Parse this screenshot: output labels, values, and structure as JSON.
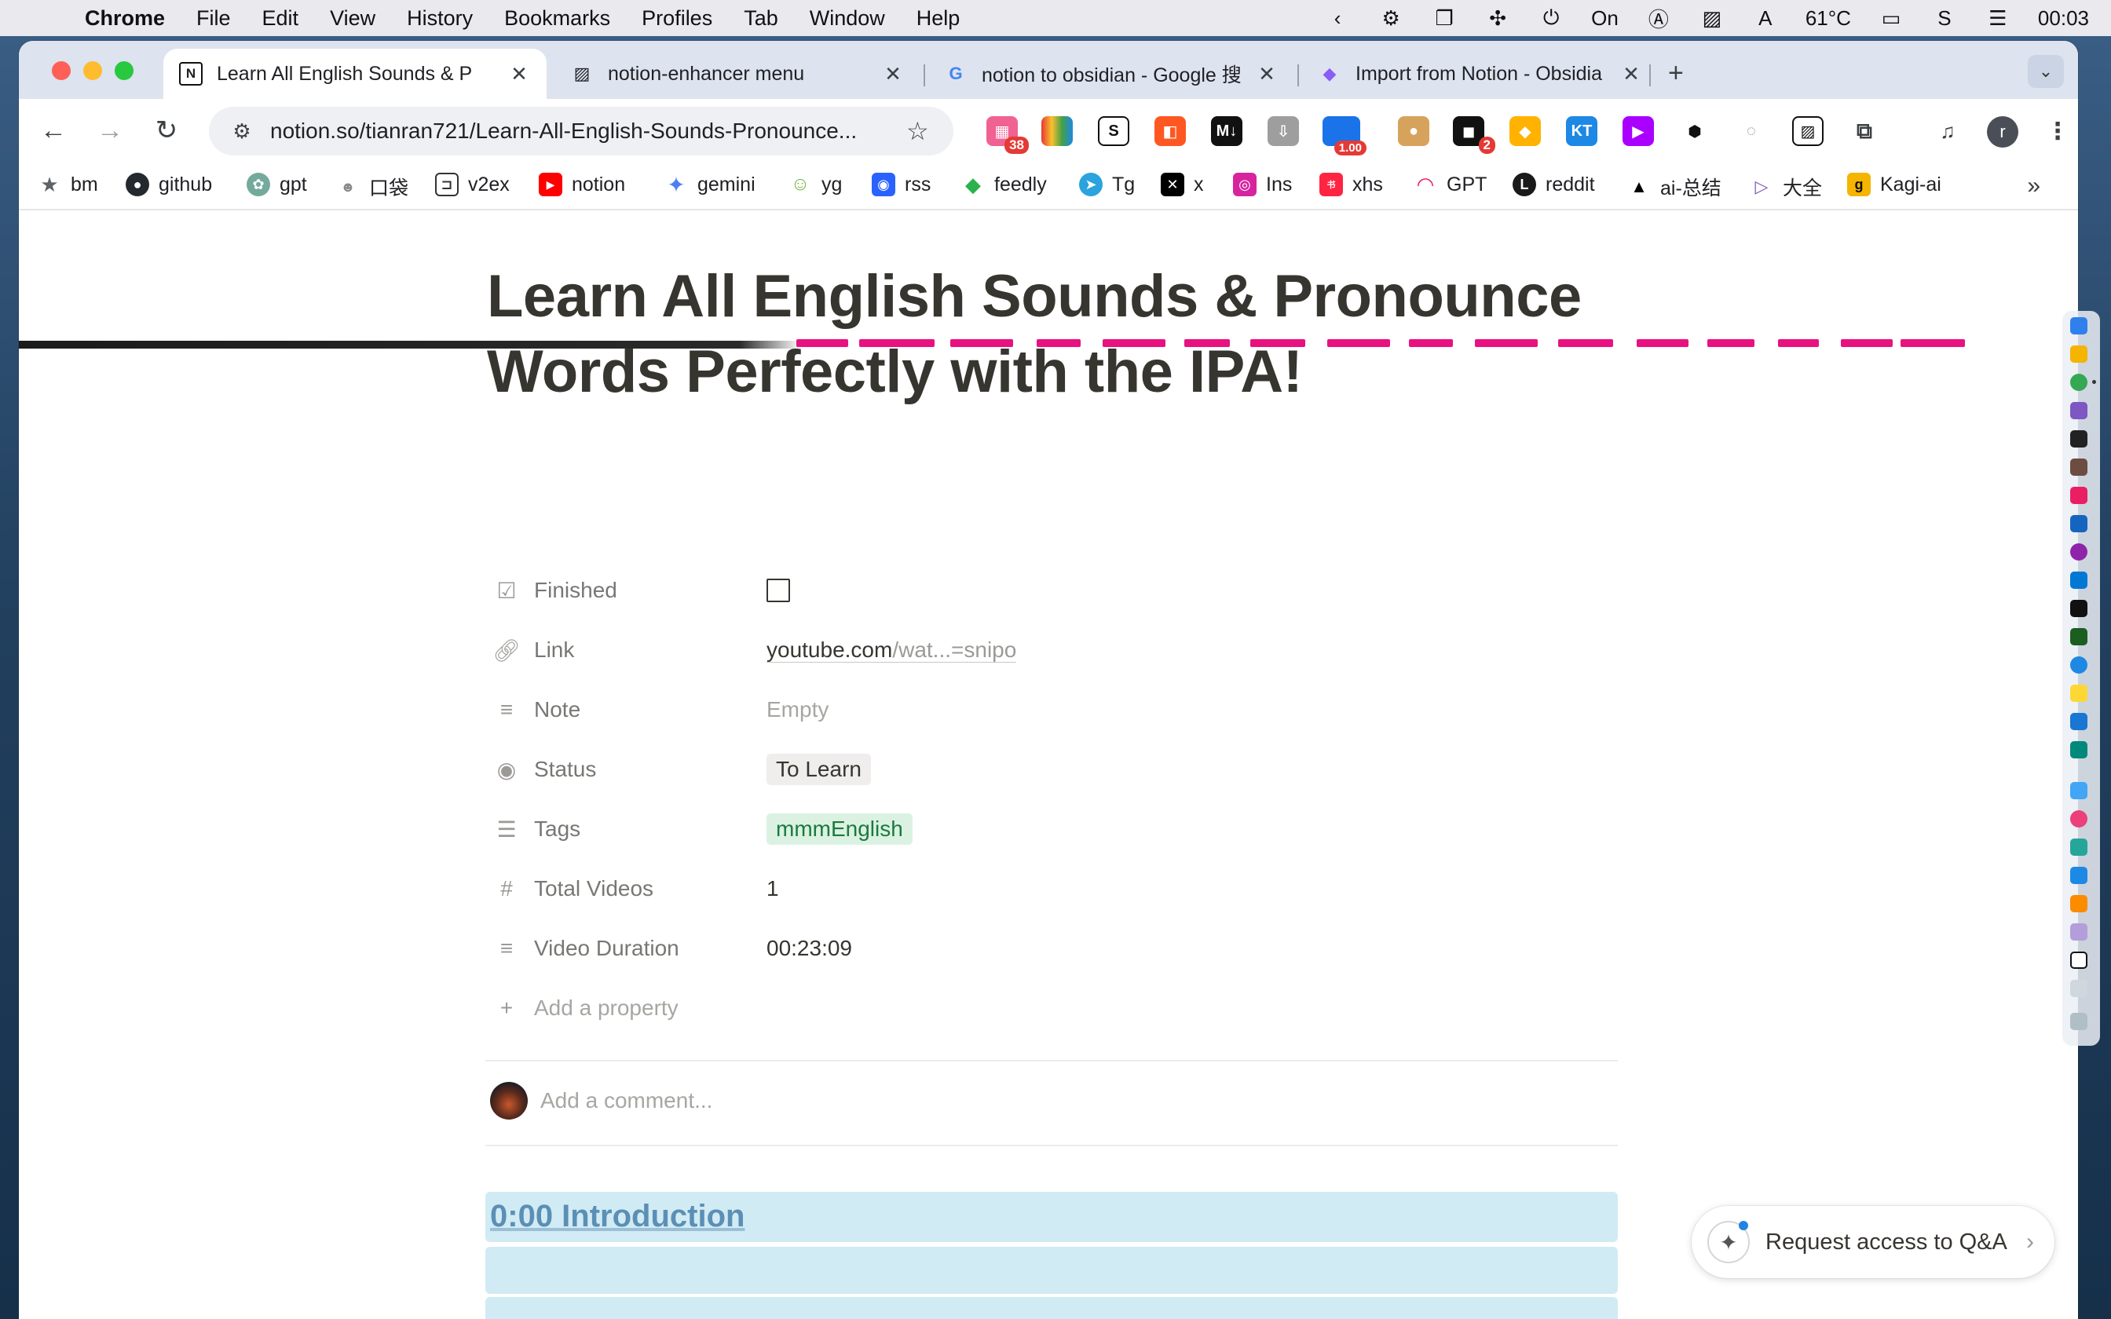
{
  "menubar": {
    "app": "Chrome",
    "items": [
      "File",
      "Edit",
      "View",
      "History",
      "Bookmarks",
      "Profiles",
      "Tab",
      "Window",
      "Help"
    ],
    "status": {
      "battery_mode": "On",
      "temperature": "61°C",
      "clock": "00:03"
    }
  },
  "tabs": [
    {
      "title": "Learn All English Sounds & P",
      "favicon": "N",
      "active": true
    },
    {
      "title": "notion-enhancer menu",
      "favicon": "▨",
      "active": false
    },
    {
      "title": "notion to obsidian - Google 搜",
      "favicon": "G",
      "active": false
    },
    {
      "title": "Import from Notion - Obsidia",
      "favicon": "◆",
      "active": false
    }
  ],
  "toolbar": {
    "url": "notion.so/tianran721/Learn-All-English-Sounds-Pronounce...",
    "extensions": {
      "badge_1": "38",
      "badge_2": "1.00",
      "badge_3": "2",
      "md_label": "M↓",
      "kt_label": "KT",
      "profile_initial": "r"
    }
  },
  "bookmarks": [
    {
      "label": "bm",
      "icon": "star-icon",
      "color": "#5f6368"
    },
    {
      "label": "github",
      "icon": "github-icon",
      "color": "#24292f"
    },
    {
      "label": "gpt",
      "icon": "openai-icon",
      "color": "#74aa9c"
    },
    {
      "label": "口袋",
      "icon": "pocket-icon",
      "color": "#8a8a8a"
    },
    {
      "label": "v2ex",
      "icon": "v2ex-icon",
      "color": "#333333"
    },
    {
      "label": "notion",
      "icon": "youtube-icon",
      "color": "#ff0000"
    },
    {
      "label": "gemini",
      "icon": "gemini-icon",
      "color": "#4f7df3"
    },
    {
      "label": "yg",
      "icon": "yg-icon",
      "color": "#7cb342"
    },
    {
      "label": "rss",
      "icon": "rss-icon",
      "color": "#2962ff"
    },
    {
      "label": "feedly",
      "icon": "feedly-icon",
      "color": "#2bb24c"
    },
    {
      "label": "Tg",
      "icon": "telegram-icon",
      "color": "#2aa3df"
    },
    {
      "label": "x",
      "icon": "x-icon",
      "color": "#000000"
    },
    {
      "label": "Ins",
      "icon": "instagram-icon",
      "color": "#d6249f"
    },
    {
      "label": "xhs",
      "icon": "xhs-icon",
      "color": "#ff2442"
    },
    {
      "label": "GPT",
      "icon": "gpt-icon",
      "color": "#e91e63"
    },
    {
      "label": "reddit",
      "icon": "reddit-icon",
      "color": "#1a1a1a"
    },
    {
      "label": "ai-总结",
      "icon": "triangle-icon",
      "color": "#000000"
    },
    {
      "label": "大全",
      "icon": "play-icon",
      "color": "#7e57c2"
    },
    {
      "label": "Kagi-ai",
      "icon": "kagi-icon",
      "color": "#f5b400"
    }
  ],
  "page": {
    "title_line1": "Learn All English Sounds & Pronounce",
    "title_line2": "Words Perfectly with the IPA!",
    "properties": {
      "finished": {
        "name": "Finished"
      },
      "link": {
        "name": "Link",
        "host": "youtube.com",
        "path": "/wat...=snipo"
      },
      "note": {
        "name": "Note",
        "value": "Empty"
      },
      "status": {
        "name": "Status",
        "value": "To Learn"
      },
      "tags": {
        "name": "Tags",
        "value": "mmmEnglish"
      },
      "total_videos": {
        "name": "Total Videos",
        "value": "1"
      },
      "video_duration": {
        "name": "Video Duration",
        "value": "00:23:09"
      }
    },
    "add_property": "Add a property",
    "comment_placeholder": "Add a comment...",
    "section_heading": "0:00 Introduction",
    "qa_button": "Request access to Q&A"
  },
  "colors": {
    "accent_pink": "#e8117f",
    "tag_green_bg": "#dbf2e2",
    "highlight_blue": "#d1ebf4"
  }
}
